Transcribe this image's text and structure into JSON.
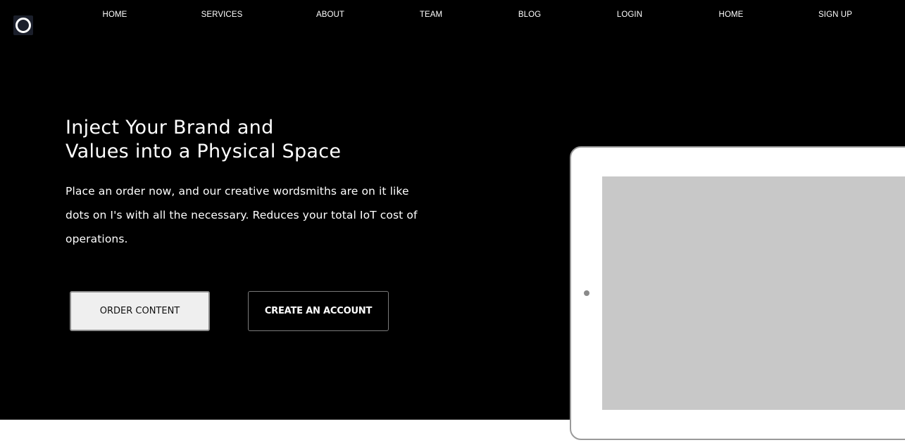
{
  "nav": {
    "items": [
      {
        "label": "HOME"
      },
      {
        "label": "SERVICES"
      },
      {
        "label": "ABOUT"
      },
      {
        "label": "TEAM"
      },
      {
        "label": "BLOG"
      },
      {
        "label": "LOGIN"
      },
      {
        "label": "HOME"
      },
      {
        "label": "SIGN UP"
      }
    ]
  },
  "hero": {
    "headline_line1": "Inject Your Brand and",
    "headline_line2": "Values into a Physical Space",
    "description": "Place an order now, and our creative wordsmiths are on it like dots on I's with all the necessary. Reduces your total IoT cost of operations.",
    "primary_button": "ORDER CONTENT",
    "secondary_button": "CREATE AN ACCOUNT"
  },
  "colors": {
    "hero_background": "#000000",
    "text": "#ffffff",
    "tablet_screen": "#c8c8c8"
  },
  "icons": {
    "logo": "ring-logo-icon",
    "tablet_camera": "camera-dot-icon"
  }
}
